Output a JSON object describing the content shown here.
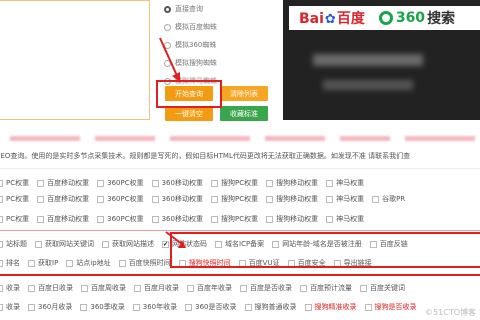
{
  "radios": [
    {
      "label": "直接查询",
      "checked": true
    },
    {
      "label": "模拟百度蜘蛛",
      "checked": false
    },
    {
      "label": "模拟360蜘蛛",
      "checked": false
    },
    {
      "label": "模拟搜狗蜘蛛",
      "checked": false
    },
    {
      "label": "模拟神马蜘蛛",
      "checked": false
    }
  ],
  "buttons": {
    "start": "开始查询",
    "clear": "清除列表",
    "one_key": "一键清空",
    "std": "收藏标准"
  },
  "banner": {
    "baidu_prefix": "Bai",
    "baidu_suffix": "百度",
    "so_number": "360",
    "so_text": "搜索"
  },
  "info": "SEO查询。使用的是实时多节点采集技术。规则都是写死的，假如目标HTML代码更改将无法获取正确数据。如发现不准 请联系我们查",
  "rows": [
    [
      "PC权重",
      "百度移动权重",
      "360PC权重",
      "360移动权重",
      "搜狗PC权重",
      "搜狗移动权重",
      "神马权重"
    ],
    [
      "PC权重",
      "百度移动权重",
      "360PC权重",
      "360移动权重",
      "搜狗PC权重",
      "搜狗移动权重",
      "神马权重",
      "谷歌PR"
    ],
    [
      "PC权重",
      "百度移动权重",
      "360PC权重",
      "360移动权重",
      "搜狗PC权重",
      "搜狗移动权重",
      "神马权重"
    ],
    [
      "站标题",
      "获取网站关键词",
      "获取网站描述",
      "网站状态码",
      "域名ICP备案",
      "网站年龄-域名是否被注册",
      "百度反链"
    ],
    [
      "排名",
      "获取IP",
      "站点ip地址",
      "百度快照时间",
      "搜狗快照时间",
      "百度VU证",
      "百度安全",
      "导出链接"
    ],
    [
      "收录",
      "百度日收录",
      "百度周收录",
      "百度月收录",
      "百度年收录",
      "百度是否收录",
      "百度预计流量",
      "百度关键词"
    ],
    [
      "收录",
      "360月收录",
      "360季收录",
      "360年收录",
      "360是否收录",
      "搜狗普通收录",
      "搜狗精准收录",
      "搜狗是否收录"
    ]
  ],
  "watermark": "©51CTO博客"
}
